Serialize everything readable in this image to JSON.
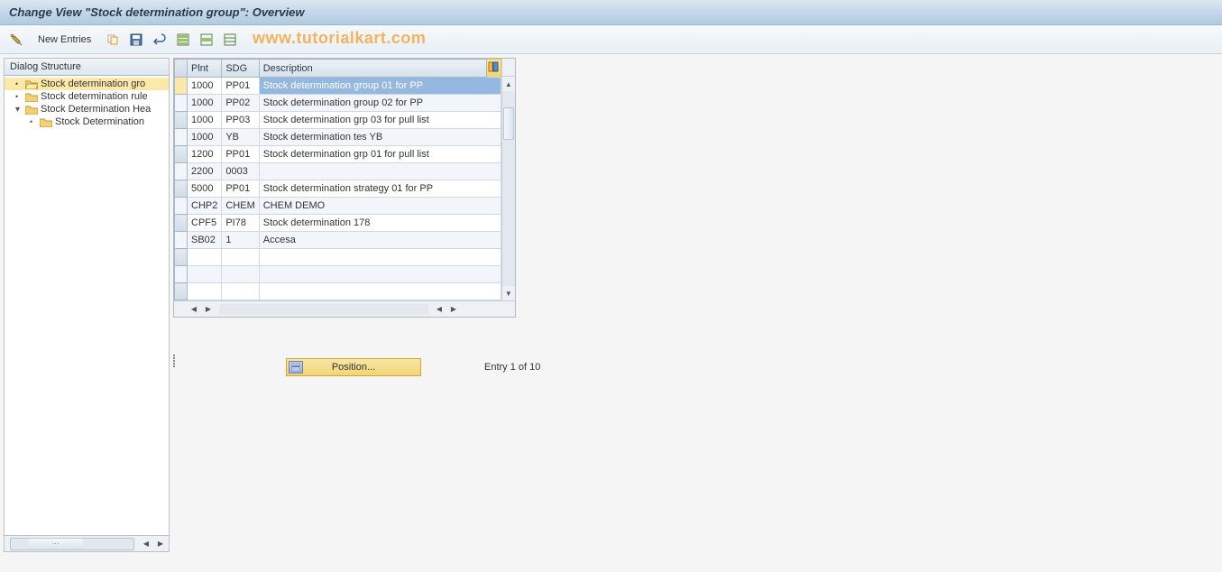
{
  "titlebar": {
    "text": "Change View \"Stock determination group\": Overview"
  },
  "toolbar": {
    "new_entries_label": "New Entries",
    "watermark": "www.tutorialkart.com"
  },
  "dialog_structure": {
    "header": "Dialog Structure",
    "items": [
      {
        "label": "Stock determination gro",
        "icon": "open-folder",
        "selected": true,
        "bullet": true
      },
      {
        "label": "Stock determination rule",
        "icon": "folder",
        "bullet": true
      },
      {
        "label": "Stock Determination Hea",
        "icon": "folder",
        "expander": true
      },
      {
        "label": "Stock Determination",
        "icon": "folder",
        "child": true
      }
    ]
  },
  "table": {
    "columns": [
      "Plnt",
      "SDG",
      "Description"
    ],
    "rows": [
      {
        "plnt": "1000",
        "sdg": "PP01",
        "desc": "Stock determination group 01 for PP",
        "selected_desc": true,
        "row_active": true
      },
      {
        "plnt": "1000",
        "sdg": "PP02",
        "desc": "Stock determination group 02 for PP"
      },
      {
        "plnt": "1000",
        "sdg": "PP03",
        "desc": "Stock determination grp 03 for pull list"
      },
      {
        "plnt": "1000",
        "sdg": "YB",
        "desc": "Stock determination tes YB"
      },
      {
        "plnt": "1200",
        "sdg": "PP01",
        "desc": "Stock determination grp 01 for pull list"
      },
      {
        "plnt": "2200",
        "sdg": "0003",
        "desc": ""
      },
      {
        "plnt": "5000",
        "sdg": "PP01",
        "desc": "Stock determination strategy 01 for PP"
      },
      {
        "plnt": "CHP2",
        "sdg": "CHEM",
        "desc": "CHEM DEMO"
      },
      {
        "plnt": "CPF5",
        "sdg": "PI78",
        "desc": "Stock determination 178"
      },
      {
        "plnt": "SB02",
        "sdg": "1",
        "desc": "Accesa"
      },
      {
        "plnt": "",
        "sdg": "",
        "desc": ""
      },
      {
        "plnt": "",
        "sdg": "",
        "desc": ""
      },
      {
        "plnt": "",
        "sdg": "",
        "desc": ""
      }
    ]
  },
  "footer": {
    "position_label": "Position...",
    "entry_text": "Entry 1 of 10"
  },
  "icons": {
    "wand": "wand-icon",
    "copy": "copy-icon",
    "save": "save-icon",
    "undo": "undo-icon",
    "grid1": "selectall-icon",
    "grid2": "grid-icon",
    "grid3": "deselect-icon",
    "table_corner": "configure-icon"
  }
}
